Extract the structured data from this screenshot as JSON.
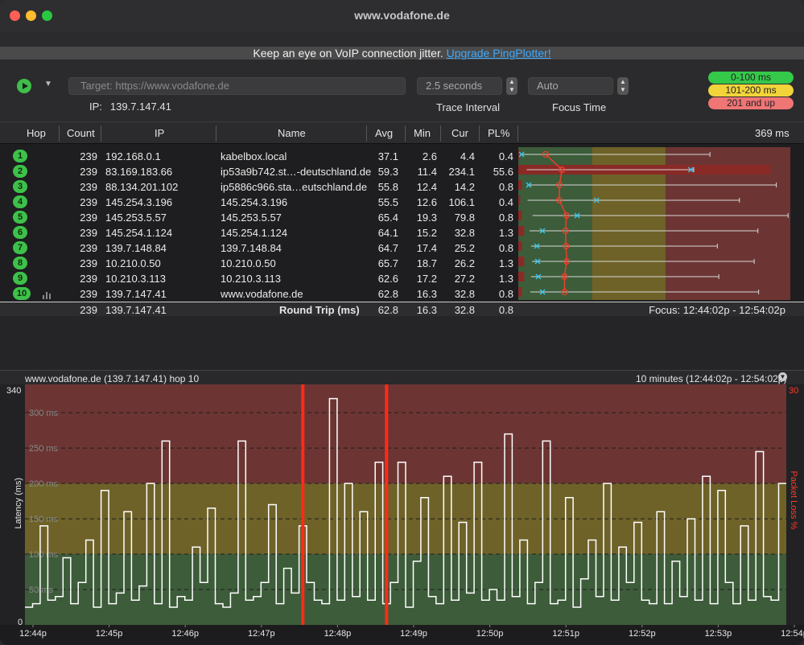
{
  "window": {
    "title": "www.vodafone.de"
  },
  "banner": {
    "text": "Keep an eye on VoIP connection jitter.",
    "link": "Upgrade PingPlotter!"
  },
  "toolbar": {
    "target_placeholder": "Target:   https://www.vodafone.de",
    "ip_label": "IP:",
    "ip_value": "139.7.147.41",
    "trace_interval_value": "2.5 seconds",
    "trace_interval_label": "Trace Interval",
    "focus_time_value": "Auto",
    "focus_time_label": "Focus Time"
  },
  "legend": {
    "green": "0-100 ms",
    "yellow": "101-200 ms",
    "red": "201 and up"
  },
  "table": {
    "headers": {
      "hop": "Hop",
      "count": "Count",
      "ip": "IP",
      "name": "Name",
      "avg": "Avg",
      "min": "Min",
      "cur": "Cur",
      "pl": "PL%",
      "scale": "369 ms"
    },
    "rows": [
      {
        "hop": "1",
        "count": "239",
        "ip": "192.168.0.1",
        "name": "kabelbox.local",
        "avg": "37.1",
        "min": "2.6",
        "cur": "4.4",
        "pl": "0.4",
        "minv": 2.6,
        "avgv": 37.1,
        "curv": 4.4,
        "maxv": 260,
        "plv": 0.4
      },
      {
        "hop": "2",
        "count": "239",
        "ip": "83.169.183.66",
        "name": "ip53a9b742.st…-deutschland.de",
        "avg": "59.3",
        "min": "11.4",
        "cur": "234.1",
        "pl": "55.6",
        "minv": 11.4,
        "avgv": 59.3,
        "curv": 234.1,
        "maxv": 238,
        "plv": 55.6
      },
      {
        "hop": "3",
        "count": "239",
        "ip": "88.134.201.102",
        "name": "ip5886c966.sta…eutschland.de",
        "avg": "55.8",
        "min": "12.4",
        "cur": "14.2",
        "pl": "0.8",
        "minv": 12.4,
        "avgv": 55.8,
        "curv": 14.2,
        "maxv": 350,
        "plv": 0.8
      },
      {
        "hop": "4",
        "count": "239",
        "ip": "145.254.3.196",
        "name": "145.254.3.196",
        "avg": "55.5",
        "min": "12.6",
        "cur": "106.1",
        "pl": "0.4",
        "minv": 12.6,
        "avgv": 55.5,
        "curv": 106.1,
        "maxv": 300,
        "plv": 0.4
      },
      {
        "hop": "5",
        "count": "239",
        "ip": "145.253.5.57",
        "name": "145.253.5.57",
        "avg": "65.4",
        "min": "19.3",
        "cur": "79.8",
        "pl": "0.8",
        "minv": 19.3,
        "avgv": 65.4,
        "curv": 79.8,
        "maxv": 366,
        "plv": 0.8
      },
      {
        "hop": "6",
        "count": "239",
        "ip": "145.254.1.124",
        "name": "145.254.1.124",
        "avg": "64.1",
        "min": "15.2",
        "cur": "32.8",
        "pl": "1.3",
        "minv": 15.2,
        "avgv": 64.1,
        "curv": 32.8,
        "maxv": 325,
        "plv": 1.3
      },
      {
        "hop": "7",
        "count": "239",
        "ip": "139.7.148.84",
        "name": "139.7.148.84",
        "avg": "64.7",
        "min": "17.4",
        "cur": "25.2",
        "pl": "0.8",
        "minv": 17.4,
        "avgv": 64.7,
        "curv": 25.2,
        "maxv": 270,
        "plv": 0.8
      },
      {
        "hop": "8",
        "count": "239",
        "ip": "10.210.0.50",
        "name": "10.210.0.50",
        "avg": "65.7",
        "min": "18.7",
        "cur": "26.2",
        "pl": "1.3",
        "minv": 18.7,
        "avgv": 65.7,
        "curv": 26.2,
        "maxv": 320,
        "plv": 1.3
      },
      {
        "hop": "9",
        "count": "239",
        "ip": "10.210.3.113",
        "name": "10.210.3.113",
        "avg": "62.6",
        "min": "17.2",
        "cur": "27.2",
        "pl": "1.3",
        "minv": 17.2,
        "avgv": 62.6,
        "curv": 27.2,
        "maxv": 272,
        "plv": 1.3
      },
      {
        "hop": "10",
        "count": "239",
        "ip": "139.7.147.41",
        "name": "www.vodafone.de",
        "avg": "62.8",
        "min": "16.3",
        "cur": "32.8",
        "pl": "0.8",
        "minv": 16.3,
        "avgv": 62.8,
        "curv": 32.8,
        "maxv": 326,
        "plv": 0.8
      }
    ],
    "summary": {
      "count": "239",
      "ip": "139.7.147.41",
      "label": "Round Trip (ms)",
      "avg": "62.8",
      "min": "16.3",
      "cur": "32.8",
      "pl": "0.8",
      "focus": "Focus: 12:44:02p - 12:54:02p"
    }
  },
  "graph": {
    "title": "www.vodafone.de (139.7.147.41) hop 10",
    "range": "10 minutes (12:44:02p - 12:54:02p)",
    "y_top": "340",
    "y_zero": "0",
    "ylabel": "Latency (ms)",
    "y2label": "Packet Loss %",
    "y2_top": "30",
    "gridlines": [
      "300 ms",
      "250 ms",
      "200 ms",
      "150 ms",
      "100 ms",
      "50 ms"
    ],
    "xticks": [
      "12:44p",
      "12:45p",
      "12:46p",
      "12:47p",
      "12:48p",
      "12:49p",
      "12:50p",
      "12:51p",
      "12:52p",
      "12:53p",
      "12:54p"
    ],
    "colors": {
      "green": "#3d5c3a",
      "yellow": "#6e6228",
      "red": "#6c3533",
      "loss": "#ff2a1a",
      "line": "#ffffff"
    }
  },
  "chart_data": {
    "type": "line",
    "title": "www.vodafone.de (139.7.147.41) hop 10",
    "xlabel": "",
    "ylabel": "Latency (ms)",
    "ylim": [
      0,
      340
    ],
    "x": [
      "12:44:02p",
      "12:44:08p",
      "12:44:14p",
      "12:44:20p",
      "12:44:26p",
      "12:44:32p",
      "12:44:38p",
      "12:44:44p",
      "12:44:50p",
      "12:44:56p",
      "12:45:02p",
      "12:45:08p",
      "12:45:14p",
      "12:45:20p",
      "12:45:26p",
      "12:45:32p",
      "12:45:38p",
      "12:45:44p",
      "12:45:50p",
      "12:45:56p",
      "12:46:02p",
      "12:46:08p",
      "12:46:14p",
      "12:46:20p",
      "12:46:26p",
      "12:46:32p",
      "12:46:38p",
      "12:46:44p",
      "12:46:50p",
      "12:46:56p",
      "12:47:02p",
      "12:47:08p",
      "12:47:14p",
      "12:47:20p",
      "12:47:26p",
      "12:47:32p",
      "12:47:38p",
      "12:47:44p",
      "12:47:50p",
      "12:47:56p",
      "12:48:02p",
      "12:48:08p",
      "12:48:14p",
      "12:48:20p",
      "12:48:26p",
      "12:48:32p",
      "12:48:38p",
      "12:48:44p",
      "12:48:50p",
      "12:48:56p",
      "12:49:02p",
      "12:49:08p",
      "12:49:14p",
      "12:49:20p",
      "12:49:26p",
      "12:49:32p",
      "12:49:38p",
      "12:49:44p",
      "12:49:50p",
      "12:49:56p",
      "12:50:02p",
      "12:50:08p",
      "12:50:14p",
      "12:50:20p",
      "12:50:26p",
      "12:50:32p",
      "12:50:38p",
      "12:50:44p",
      "12:50:50p",
      "12:50:56p",
      "12:51:02p",
      "12:51:08p",
      "12:51:14p",
      "12:51:20p",
      "12:51:26p",
      "12:51:32p",
      "12:51:38p",
      "12:51:44p",
      "12:51:50p",
      "12:51:56p",
      "12:52:02p",
      "12:52:08p",
      "12:52:14p",
      "12:52:20p",
      "12:52:26p",
      "12:52:32p",
      "12:52:38p",
      "12:52:44p",
      "12:52:50p",
      "12:52:56p",
      "12:53:02p",
      "12:53:08p",
      "12:53:14p",
      "12:53:20p",
      "12:53:26p",
      "12:53:32p",
      "12:53:38p",
      "12:53:44p",
      "12:53:50p",
      "12:53:56p"
    ],
    "series": [
      {
        "values": [
          25,
          30,
          140,
          35,
          40,
          95,
          30,
          60,
          120,
          25,
          190,
          30,
          45,
          160,
          35,
          55,
          200,
          30,
          260,
          25,
          40,
          35,
          110,
          60,
          165,
          30,
          25,
          45,
          260,
          35,
          40,
          60,
          170,
          30,
          80,
          45,
          140,
          60,
          35,
          30,
          320,
          35,
          200,
          40,
          160,
          35,
          230,
          30,
          60,
          230,
          25,
          90,
          180,
          40,
          30,
          210,
          35,
          145,
          45,
          230,
          35,
          50,
          35,
          270,
          40,
          120,
          30,
          60,
          260,
          30,
          35,
          180,
          25,
          65,
          120,
          40,
          200,
          35,
          110,
          60,
          145,
          35,
          30,
          160,
          30,
          90,
          40,
          150,
          35,
          210,
          30,
          190,
          60,
          30,
          140,
          35,
          245,
          40,
          35,
          200
        ]
      },
      {
        "name": "Packet Loss %",
        "loss_markers_x": [
          "12:47:38p",
          "12:48:44p"
        ]
      }
    ]
  }
}
